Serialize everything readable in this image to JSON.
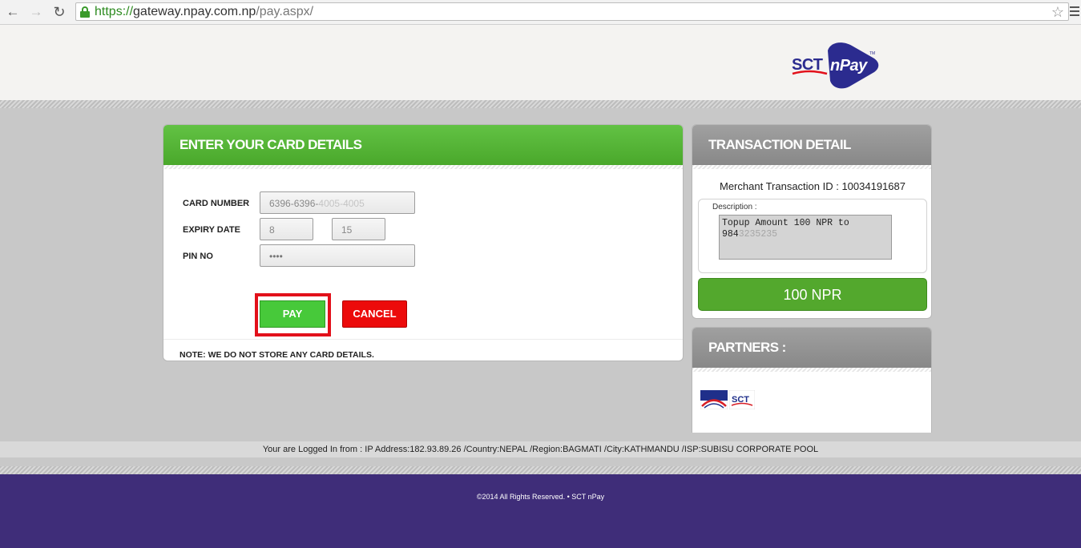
{
  "browser": {
    "url_scheme": "https://",
    "url_host": "gateway.npay.com.np",
    "url_path": "/pay.aspx/"
  },
  "brand": {
    "logo_sct": "SCT",
    "logo_npay": "nPay",
    "logo_tm": "TM"
  },
  "card_form": {
    "title": "ENTER YOUR CARD DETAILS",
    "card_number_label": "CARD NUMBER",
    "card_number_visible": "6396-6396-",
    "card_number_blurred": "4005-4005",
    "expiry_label": "EXPIRY DATE",
    "expiry_month": "8",
    "expiry_year": "15",
    "pin_label": "PIN NO",
    "pin_value": "••••",
    "pay_label": "PAY",
    "cancel_label": "CANCEL",
    "note": "NOTE: WE DO NOT STORE ANY CARD DETAILS."
  },
  "transaction": {
    "title": "TRANSACTION DETAIL",
    "merchant_id_text": "Merchant Transaction ID : 10034191687",
    "description_label": "Description :",
    "description_line1": "Topup Amount 100 NPR to",
    "description_line2_visible": "984",
    "description_line2_blurred": "3235235",
    "amount": "100 NPR"
  },
  "partners": {
    "title": "PARTNERS :",
    "sct_logo_text": "SCT"
  },
  "login_info": "Your are Logged In from : IP Address:182.93.89.26 /Country:NEPAL /Region:BAGMATI /City:KATHMANDU /ISP:SUBISU CORPORATE POOL",
  "footer": {
    "copyright": "©2014 All Rights Reserved.  •  SCT nPay"
  },
  "colors": {
    "green_header": "#55b437",
    "pay_green": "#47c93a",
    "cancel_red": "#ec0b0b",
    "highlight_red": "#e2101a",
    "footer_purple": "#3f2d79",
    "amount_green": "#53a82d",
    "npay_blue": "#2b2b8f"
  }
}
